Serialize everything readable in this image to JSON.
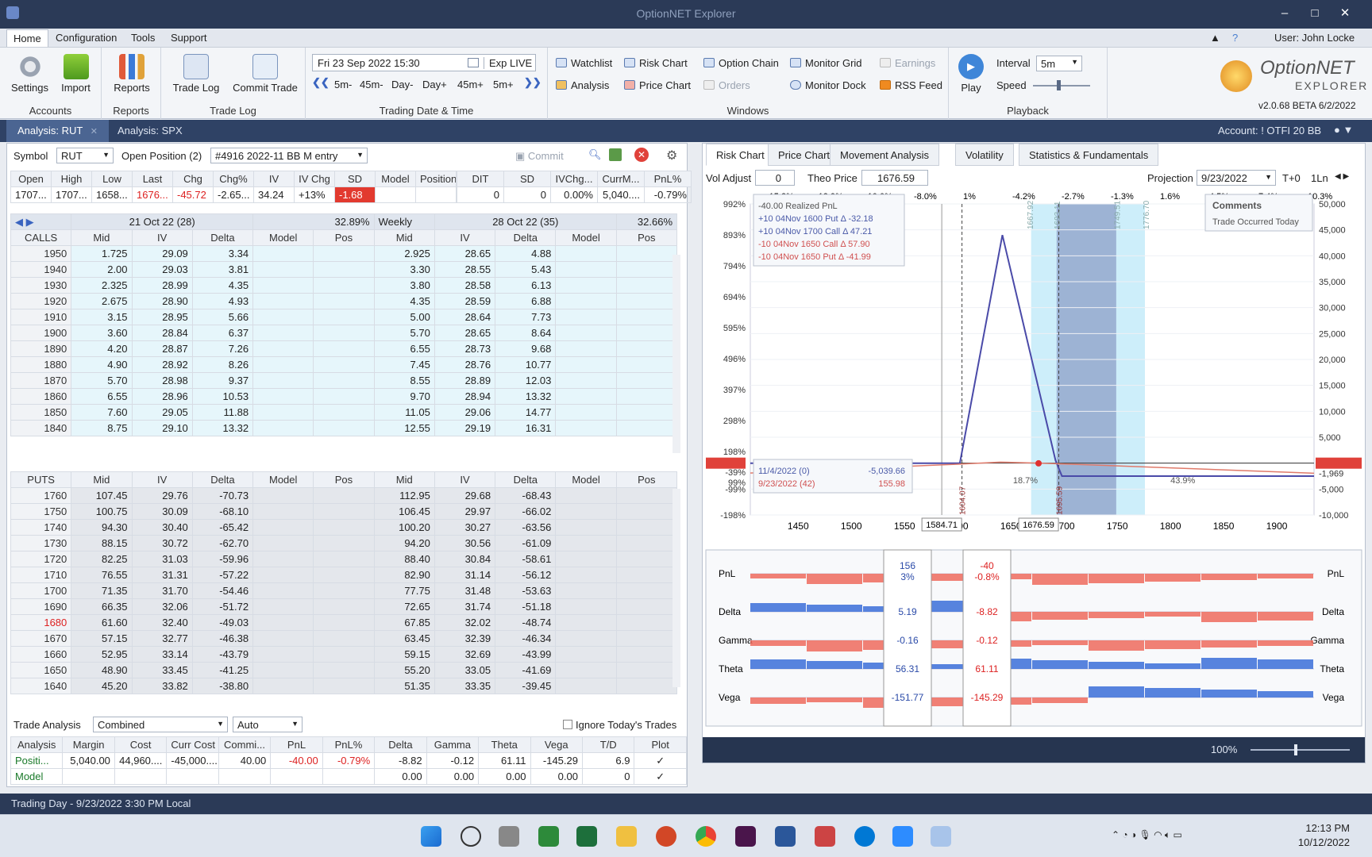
{
  "app": {
    "title": "OptionNET Explorer",
    "user": "User: John Locke"
  },
  "menu": [
    "Home",
    "Configuration",
    "Tools",
    "Support"
  ],
  "ribbon": {
    "accounts": {
      "caption": "Accounts",
      "settings": "Settings",
      "import": "Import"
    },
    "reports": {
      "caption": "Reports",
      "reports": "Reports"
    },
    "tradelog": {
      "caption": "Trade Log",
      "trade_log": "Trade Log",
      "commit_trade": "Commit Trade"
    },
    "tdt": {
      "caption": "Trading Date & Time",
      "date": "Fri 23 Sep 2022 15:30",
      "exp": "Exp LIVE",
      "steps": [
        "5m-",
        "45m-",
        "Day-",
        "Day+",
        "45m+",
        "5m+"
      ]
    },
    "windows": {
      "caption": "Windows",
      "watchlist": "Watchlist",
      "analysis": "Analysis",
      "risk_chart": "Risk Chart",
      "price_chart": "Price Chart",
      "option_chain": "Option Chain",
      "orders": "Orders",
      "monitor_grid": "Monitor Grid",
      "monitor_dock": "Monitor Dock",
      "earnings": "Earnings",
      "rss_feed": "RSS Feed"
    },
    "playback": {
      "caption": "Playback",
      "play": "Play",
      "interval_label": "Interval",
      "interval": "5m",
      "speed_label": "Speed"
    },
    "logo": {
      "name": "OptionNET",
      "sub": "EXPLORER",
      "version": "v2.0.68 BETA 6/2/2022"
    }
  },
  "doctabs": {
    "tab1": "Analysis: RUT",
    "tab2": "Analysis: SPX",
    "account": "Account: ! OTFI 20 BB"
  },
  "symbolbar": {
    "symbol_label": "Symbol",
    "symbol": "RUT",
    "open_pos_label": "Open Position (2)",
    "position": "#4916 2022-11 BB M entry",
    "commit": "Commit"
  },
  "quote": {
    "headers": [
      "Open",
      "High",
      "Low",
      "Last",
      "Chg",
      "Chg%",
      "IV",
      "IV Chg",
      "SD",
      "Model",
      "Position"
    ],
    "values": [
      "1707...",
      "1707...",
      "1658...",
      "1676...",
      "-45.72",
      "-2.65...",
      "34.24",
      "+13%",
      "-1.68",
      "",
      ""
    ],
    "headers2": [
      "DIT",
      "SD",
      "IVChg...",
      "CurrM...",
      "PnL%"
    ],
    "values2": [
      "0",
      "0",
      "0.00%",
      "5,040....",
      "-0.79%"
    ]
  },
  "chain": {
    "exp1": {
      "label": "21 Oct 22 (28)",
      "iv": "32.89%"
    },
    "exp2": {
      "label": "28 Oct 22 (35)",
      "iv": "32.66%",
      "week": "Weekly"
    },
    "calls_label": "CALLS",
    "puts_label": "PUTS",
    "cols": [
      "Mid",
      "IV",
      "Delta",
      "Model",
      "Pos"
    ],
    "calls": [
      [
        "1950",
        "1.725",
        "29.09",
        "3.34",
        "2.925",
        "28.65",
        "4.88"
      ],
      [
        "1940",
        "2.00",
        "29.03",
        "3.81",
        "3.30",
        "28.55",
        "5.43"
      ],
      [
        "1930",
        "2.325",
        "28.99",
        "4.35",
        "3.80",
        "28.58",
        "6.13"
      ],
      [
        "1920",
        "2.675",
        "28.90",
        "4.93",
        "4.35",
        "28.59",
        "6.88"
      ],
      [
        "1910",
        "3.15",
        "28.95",
        "5.66",
        "5.00",
        "28.64",
        "7.73"
      ],
      [
        "1900",
        "3.60",
        "28.84",
        "6.37",
        "5.70",
        "28.65",
        "8.64"
      ],
      [
        "1890",
        "4.20",
        "28.87",
        "7.26",
        "6.55",
        "28.73",
        "9.68"
      ],
      [
        "1880",
        "4.90",
        "28.92",
        "8.26",
        "7.45",
        "28.76",
        "10.77"
      ],
      [
        "1870",
        "5.70",
        "28.98",
        "9.37",
        "8.55",
        "28.89",
        "12.03"
      ],
      [
        "1860",
        "6.55",
        "28.96",
        "10.53",
        "9.70",
        "28.94",
        "13.32"
      ],
      [
        "1850",
        "7.60",
        "29.05",
        "11.88",
        "11.05",
        "29.06",
        "14.77"
      ],
      [
        "1840",
        "8.75",
        "29.10",
        "13.32",
        "12.55",
        "29.19",
        "16.31"
      ]
    ],
    "puts": [
      [
        "1760",
        "107.45",
        "29.76",
        "-70.73",
        "112.95",
        "29.68",
        "-68.43"
      ],
      [
        "1750",
        "100.75",
        "30.09",
        "-68.10",
        "106.45",
        "29.97",
        "-66.02"
      ],
      [
        "1740",
        "94.30",
        "30.40",
        "-65.42",
        "100.20",
        "30.27",
        "-63.56"
      ],
      [
        "1730",
        "88.15",
        "30.72",
        "-62.70",
        "94.20",
        "30.56",
        "-61.09"
      ],
      [
        "1720",
        "82.25",
        "31.03",
        "-59.96",
        "88.40",
        "30.84",
        "-58.61"
      ],
      [
        "1710",
        "76.55",
        "31.31",
        "-57.22",
        "82.90",
        "31.14",
        "-56.12"
      ],
      [
        "1700",
        "71.35",
        "31.70",
        "-54.46",
        "77.75",
        "31.48",
        "-53.63"
      ],
      [
        "1690",
        "66.35",
        "32.06",
        "-51.72",
        "72.65",
        "31.74",
        "-51.18"
      ],
      [
        "1680",
        "61.60",
        "32.40",
        "-49.03",
        "67.85",
        "32.02",
        "-48.74"
      ],
      [
        "1670",
        "57.15",
        "32.77",
        "-46.38",
        "63.45",
        "32.39",
        "-46.34"
      ],
      [
        "1660",
        "52.95",
        "33.14",
        "-43.79",
        "59.15",
        "32.69",
        "-43.99"
      ],
      [
        "1650",
        "48.90",
        "33.45",
        "-41.25",
        "55.20",
        "33.05",
        "-41.69"
      ],
      [
        "1640",
        "45.20",
        "33.82",
        "-38.80",
        "51.35",
        "33.35",
        "-39.45"
      ]
    ]
  },
  "trade_analysis": {
    "label": "Trade Analysis",
    "mode": "Combined",
    "auto": "Auto",
    "ignore": "Ignore Today's Trades",
    "headers": [
      "Analysis",
      "Margin",
      "Cost",
      "Curr Cost",
      "Commi...",
      "PnL",
      "PnL%",
      "Delta",
      "Gamma",
      "Theta",
      "Vega",
      "T/D",
      "Plot"
    ],
    "rows": [
      [
        "Positi...",
        "5,040.00",
        "44,960....",
        "-45,000....",
        "40.00",
        "-40.00",
        "-0.79%",
        "-8.82",
        "-0.12",
        "61.11",
        "-145.29",
        "6.9",
        "✓"
      ],
      [
        "Model",
        "",
        "",
        "",
        "",
        "",
        "",
        "0.00",
        "0.00",
        "0.00",
        "0.00",
        "0",
        "✓"
      ]
    ]
  },
  "charttabs": [
    "Risk Chart",
    "Price Chart",
    "Movement Analysis",
    "Volatility",
    "Statistics & Fundamentals"
  ],
  "chartctl": {
    "vol_label": "Vol Adjust",
    "vol": "0",
    "theo_label": "Theo Price",
    "theo": "1676.59",
    "proj_label": "Projection",
    "proj": "9/23/2022",
    "t0": "T+0",
    "ln": "1Ln"
  },
  "chart_data": {
    "type": "line",
    "x_ticks": [
      "1450",
      "1500",
      "1550",
      "1600",
      "1650",
      "1700",
      "1750",
      "1800",
      "1850",
      "1900"
    ],
    "top_pct": [
      "-15.8%",
      "-12.9%",
      "-10.0%",
      "-8.0%",
      "1%",
      "-4.2%",
      "-2.7%",
      "-1.3%",
      "1.6%",
      "4.5%",
      "7.4%",
      "10.3%"
    ],
    "y_left": [
      "992%",
      "893%",
      "794%",
      "694%",
      "595%",
      "496%",
      "397%",
      "298%",
      "198%",
      "99%",
      "-1%",
      "-39%",
      "-99%",
      "-198%"
    ],
    "y_right": [
      "50,000",
      "45,000",
      "40,000",
      "35,000",
      "30,000",
      "25,000",
      "20,000",
      "15,000",
      "10,000",
      "5,000",
      "-40",
      "-1,969",
      "-5,000",
      "-10,000"
    ],
    "xlim": [
      1405,
      1935
    ],
    "ylim": [
      -10000,
      50000
    ],
    "series": [
      {
        "color": "#4a4aa8",
        "x": [
          1405,
          1602,
          1642,
          1692,
          1698,
          1705,
          1935
        ],
        "y": [
          -12,
          -12,
          44000,
          500,
          -2500,
          -2500,
          -2500
        ]
      },
      {
        "color": "#e07a6a",
        "x": [
          1405,
          1600,
          1640,
          1676,
          1720,
          1935
        ],
        "y": [
          -1900,
          -200,
          200,
          0,
          -300,
          -1950
        ]
      }
    ],
    "legend": [
      "-40.00 Realized PnL",
      "+10 04Nov 1600 Put Δ  -32.18",
      "+10 04Nov 1700 Call Δ  47.21",
      "-10 04Nov 1650 Call Δ  57.90",
      "-10 04Nov 1650 Put Δ  -41.99"
    ],
    "comments_title": "Comments",
    "comments_text": "Trade Occurred Today",
    "info": [
      "11/4/2022 (0)",
      "-5,039.66",
      "9/23/2022 (42)",
      "155.98"
    ],
    "vlabels": [
      "1667.92",
      "1693.11",
      "1749.51",
      "1776.70",
      "1604.07",
      "1695.59"
    ],
    "pct_labels": [
      "18.7%",
      "43.9%"
    ],
    "cursor1": "1584.71",
    "cursor2": "1676.59"
  },
  "greeks": {
    "labels": [
      "PnL",
      "Delta",
      "Gamma",
      "Theta",
      "Vega"
    ],
    "c1": [
      "156",
      "3%",
      "5.19",
      "-0.16",
      "56.31",
      "-151.77"
    ],
    "c2": [
      "-40",
      "-0.8%",
      "-8.82",
      "-0.12",
      "61.11",
      "-145.29"
    ]
  },
  "zoom": "100%",
  "status": "Trading Day - 9/23/2022 3:30 PM Local",
  "clock": {
    "time": "12:13 PM",
    "date": "10/12/2022"
  }
}
